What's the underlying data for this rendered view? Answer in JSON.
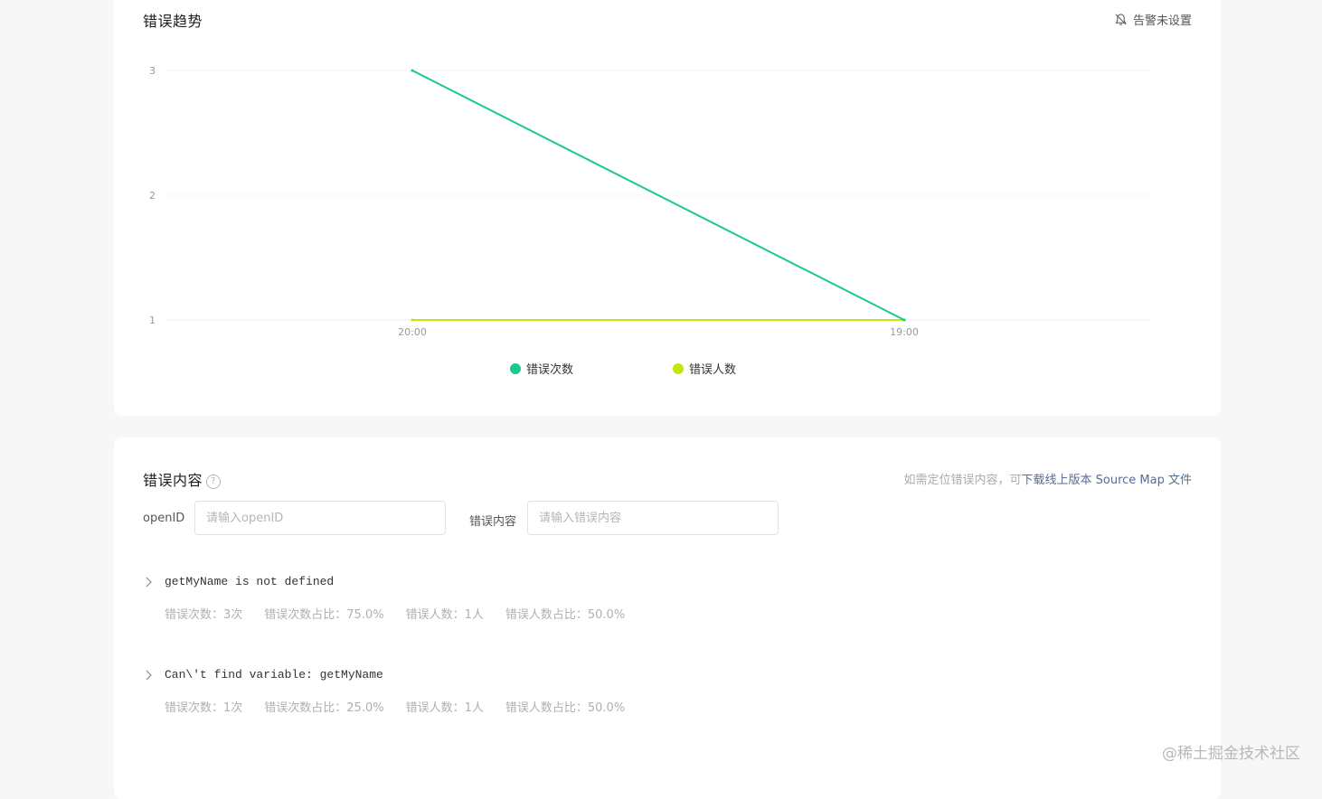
{
  "trend_card": {
    "title": "错误趋势",
    "alert_label": "告警未设置"
  },
  "chart_data": {
    "type": "line",
    "categories": [
      "20:00",
      "19:00"
    ],
    "series": [
      {
        "name": "错误次数",
        "values": [
          3,
          1
        ],
        "color": "#1cc88a"
      },
      {
        "name": "错误人数",
        "values": [
          1,
          1
        ],
        "color": "#c5e60c"
      }
    ],
    "yticks": [
      "1",
      "2",
      "3"
    ],
    "ylim": [
      1,
      3
    ],
    "grid": true,
    "legend": "bottom-center"
  },
  "errors_card": {
    "title": "错误内容",
    "help_icon": "?",
    "hint_prefix": "如需定位错误内容，可",
    "hint_link": "下载线上版本 Source Map 文件",
    "filters": {
      "openid_label": "openID",
      "openid_placeholder": "请输入openID",
      "content_label": "错误内容",
      "content_placeholder": "请输入错误内容"
    },
    "items": [
      {
        "message": "getMyName is not defined",
        "count": "错误次数：3次",
        "count_ratio": "错误次数占比：75.0%",
        "users": "错误人数：1人",
        "users_ratio": "错误人数占比：50.0%"
      },
      {
        "message": "Can\\'t find variable: getMyName",
        "count": "错误次数：1次",
        "count_ratio": "错误次数占比：25.0%",
        "users": "错误人数：1人",
        "users_ratio": "错误人数占比：50.0%"
      }
    ]
  },
  "watermark": "@稀土掘金技术社区"
}
